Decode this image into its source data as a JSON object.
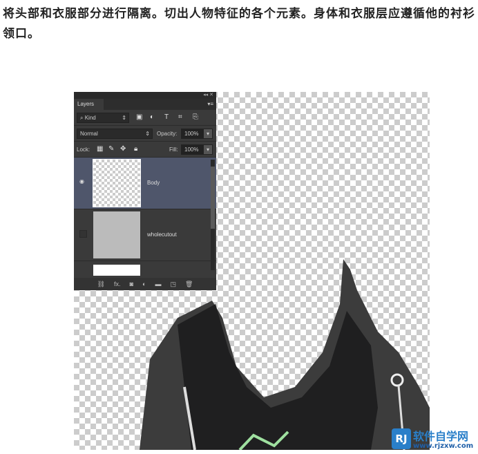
{
  "caption": "将头部和衣服部分进行隔离。切出人物特征的各个元素。身体和衣服层应遵循他的衬衫领口。",
  "panel": {
    "collapse": "◂◂",
    "close": "✕",
    "tab": "Layers",
    "menu": "▾≡",
    "filter": "Kind",
    "blend_mode": "Normal",
    "opacity_label": "Opacity:",
    "opacity": "100%",
    "lock_label": "Lock:",
    "fill_label": "Fill:",
    "fill": "100%",
    "layers": [
      {
        "name": "Body",
        "visible": true,
        "selected": true
      },
      {
        "name": "wholecutout",
        "visible": false,
        "selected": false
      }
    ],
    "footer_icons": [
      "link-icon",
      "fx-icon",
      "mask-icon",
      "adjustment-icon",
      "folder-icon",
      "new-layer-icon",
      "trash-icon"
    ],
    "fx": "fx."
  },
  "watermark": {
    "brand": "软件自学网",
    "url": "www.rjzxw.com",
    "logo": "RJ"
  }
}
